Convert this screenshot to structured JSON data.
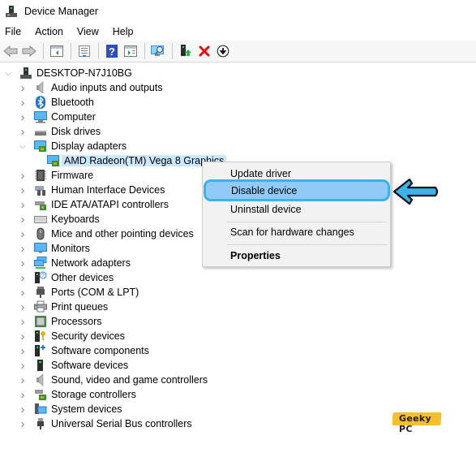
{
  "window": {
    "title": "Device Manager"
  },
  "menubar": [
    "File",
    "Action",
    "View",
    "Help"
  ],
  "toolbar": {
    "buttons": [
      "back-icon",
      "forward-icon",
      "show-hide-console-tree-icon",
      "properties-icon",
      "help-icon",
      "action-pane-icon",
      "scan-hardware-icon",
      "update-driver-icon",
      "uninstall-icon",
      "disable-icon"
    ]
  },
  "tree": {
    "root": "DESKTOP-N7J10BG",
    "categories": [
      {
        "label": "Audio inputs and outputs",
        "icon": "speaker-icon",
        "expanded": false
      },
      {
        "label": "Bluetooth",
        "icon": "bluetooth-icon",
        "expanded": false
      },
      {
        "label": "Computer",
        "icon": "computer-icon",
        "expanded": false
      },
      {
        "label": "Disk drives",
        "icon": "disk-drive-icon",
        "expanded": false
      },
      {
        "label": "Display adapters",
        "icon": "display-adapter-icon",
        "expanded": true,
        "children": [
          {
            "label": "AMD Radeon(TM) Vega 8 Graphics",
            "icon": "display-adapter-icon",
            "selected": true
          }
        ]
      },
      {
        "label": "Firmware",
        "icon": "firmware-icon",
        "expanded": false
      },
      {
        "label": "Human Interface Devices",
        "icon": "hid-icon",
        "expanded": false
      },
      {
        "label": "IDE ATA/ATAPI controllers",
        "icon": "ide-controller-icon",
        "expanded": false
      },
      {
        "label": "Keyboards",
        "icon": "keyboard-icon",
        "expanded": false
      },
      {
        "label": "Mice and other pointing devices",
        "icon": "mouse-icon",
        "expanded": false
      },
      {
        "label": "Monitors",
        "icon": "monitor-icon",
        "expanded": false
      },
      {
        "label": "Network adapters",
        "icon": "network-adapter-icon",
        "expanded": false
      },
      {
        "label": "Other devices",
        "icon": "other-devices-icon",
        "expanded": false
      },
      {
        "label": "Ports (COM & LPT)",
        "icon": "port-icon",
        "expanded": false
      },
      {
        "label": "Print queues",
        "icon": "printer-icon",
        "expanded": false
      },
      {
        "label": "Processors",
        "icon": "processor-icon",
        "expanded": false
      },
      {
        "label": "Security devices",
        "icon": "security-device-icon",
        "expanded": false
      },
      {
        "label": "Software components",
        "icon": "software-component-icon",
        "expanded": false
      },
      {
        "label": "Software devices",
        "icon": "software-device-icon",
        "expanded": false
      },
      {
        "label": "Sound, video and game controllers",
        "icon": "speaker-icon",
        "expanded": false
      },
      {
        "label": "Storage controllers",
        "icon": "storage-controller-icon",
        "expanded": false
      },
      {
        "label": "System devices",
        "icon": "system-device-icon",
        "expanded": false
      },
      {
        "label": "Universal Serial Bus controllers",
        "icon": "usb-icon",
        "expanded": false
      }
    ]
  },
  "context_menu": {
    "items": [
      {
        "label": "Update driver"
      },
      {
        "label": "Disable device",
        "highlighted": true
      },
      {
        "label": "Uninstall device"
      },
      {
        "label": "Scan for hardware changes"
      },
      {
        "label": "Properties",
        "bold": true
      }
    ]
  },
  "annotation": {
    "arrow_color": "#3bb3e8",
    "highlight_color": "#91c9f7"
  },
  "watermark": {
    "text": "Geeky PC",
    "color": "#f6c02c"
  }
}
